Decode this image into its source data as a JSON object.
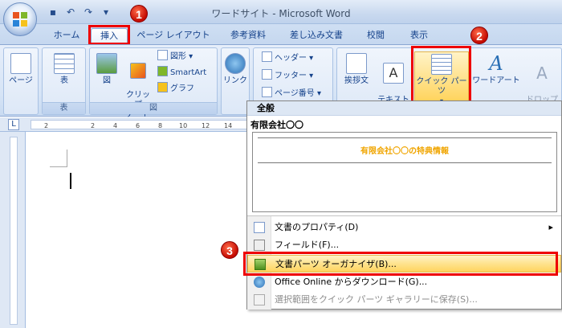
{
  "window": {
    "title": "ワードサイト - Microsoft Word"
  },
  "qat": [
    {
      "icon": "save-icon",
      "glyph": "▪"
    },
    {
      "icon": "undo-icon",
      "glyph": "↶"
    },
    {
      "icon": "redo-icon",
      "glyph": "↷"
    },
    {
      "icon": "customize-qat-icon",
      "glyph": "▾"
    }
  ],
  "tabs": [
    "ホーム",
    "挿入",
    "ページ レイアウト",
    "参考資料",
    "差し込み文書",
    "校閲",
    "表示"
  ],
  "active_tab": "挿入",
  "ribbon": {
    "pages_label": "ページ",
    "table_label": "表",
    "table_group": "表",
    "picture_label": "図",
    "clipart_label": "クリップ\nアート",
    "shapes_label": "図形",
    "smartart_label": "SmartArt",
    "graph_label": "グラフ",
    "illust_group": "図",
    "link_label": "リンク",
    "header_label": "ヘッダー",
    "footer_label": "フッター",
    "page_number_label": "ページ番号",
    "insert_text_label": "挨拶文",
    "textbox_label": "テキスト\nボックス",
    "quickparts_label": "クイック パーツ",
    "wordart_label": "ワードアート",
    "dropcap_label": "ドロップ\nキャップ"
  },
  "ruler": {
    "numbers": [
      "2",
      "",
      "2",
      "4",
      "6",
      "8",
      "10",
      "12",
      "14"
    ]
  },
  "dropdown": {
    "header": "全般",
    "entry_title": "有限会社〇〇",
    "preview_text": "有限会社〇〇の特典情報",
    "items": [
      {
        "label": "文書のプロパティ(D)",
        "icon": "document-properties-icon"
      },
      {
        "label": "フィールド(F)...",
        "icon": "field-icon"
      },
      {
        "label": "文書パーツ オーガナイザ(B)...",
        "icon": "building-blocks-organizer-icon"
      },
      {
        "label": "Office Online からダウンロード(G)...",
        "icon": "office-online-icon"
      },
      {
        "label": "選択範囲をクイック パーツ ギャラリーに保存(S)...",
        "icon": "save-selection-icon"
      }
    ]
  },
  "annotations": [
    "1",
    "2",
    "3"
  ]
}
